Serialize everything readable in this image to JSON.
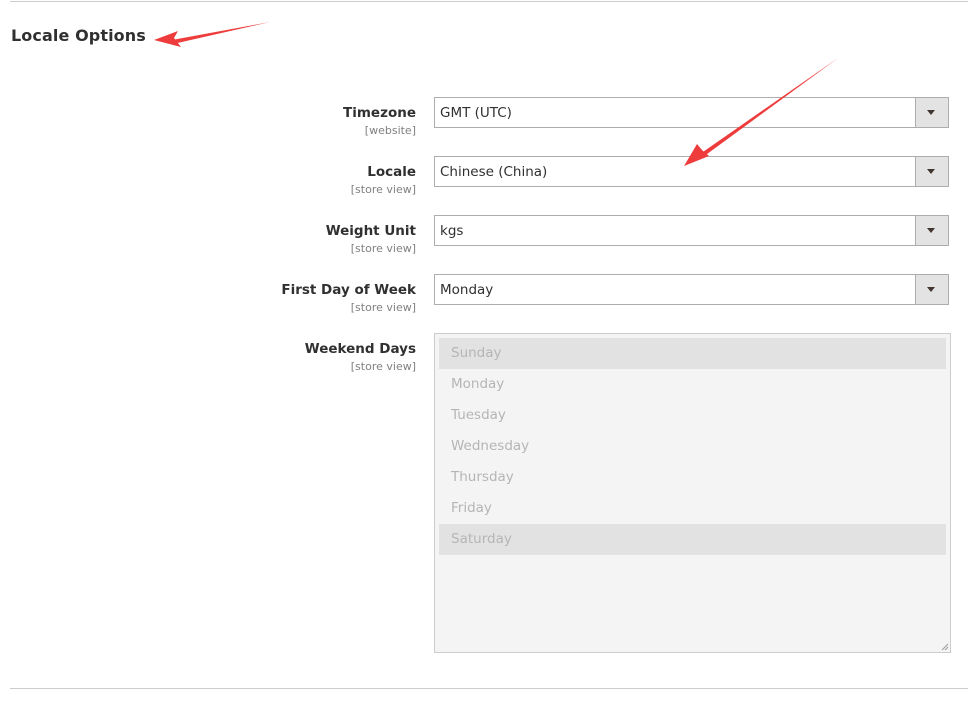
{
  "section": {
    "title": "Locale Options"
  },
  "fields": [
    {
      "label": "Timezone",
      "scope": "[website]",
      "value": "GMT (UTC)"
    },
    {
      "label": "Locale",
      "scope": "[store view]",
      "value": "Chinese (China)"
    },
    {
      "label": "Weight Unit",
      "scope": "[store view]",
      "value": "kgs"
    },
    {
      "label": "First Day of Week",
      "scope": "[store view]",
      "value": "Monday"
    }
  ],
  "weekend": {
    "label": "Weekend Days",
    "scope": "[store view]",
    "options": [
      "Sunday",
      "Monday",
      "Tuesday",
      "Wednesday",
      "Thursday",
      "Friday",
      "Saturday"
    ],
    "selected": [
      "Sunday",
      "Saturday"
    ],
    "disabled": true
  },
  "colors": {
    "annotation_arrow": "#ee3b3b",
    "select_button": "#e3e3e3",
    "disabled_background": "#f4f4f4"
  },
  "icons": {
    "dropdown": "chevron-down-icon",
    "annotation": "red-arrow-icon"
  }
}
